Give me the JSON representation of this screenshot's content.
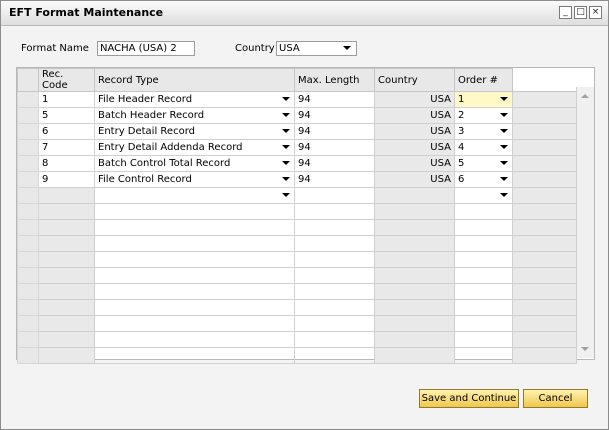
{
  "window": {
    "title": "EFT Format Maintenance"
  },
  "form": {
    "format_name_label": "Format Name",
    "format_name_value": "NACHA (USA) 2",
    "country_label": "Country",
    "country_value": "USA"
  },
  "grid": {
    "columns": [
      "Rec. Code",
      "Record Type",
      "Max. Length",
      "Country",
      "Order #"
    ],
    "rows": [
      {
        "code": "1",
        "type": "File Header Record",
        "length": "94",
        "country": "USA",
        "order": "1"
      },
      {
        "code": "5",
        "type": "Batch Header Record",
        "length": "94",
        "country": "USA",
        "order": "2"
      },
      {
        "code": "6",
        "type": "Entry Detail Record",
        "length": "94",
        "country": "USA",
        "order": "3"
      },
      {
        "code": "7",
        "type": "Entry Detail Addenda Record",
        "length": "94",
        "country": "USA",
        "order": "4"
      },
      {
        "code": "8",
        "type": "Batch Control Total Record",
        "length": "94",
        "country": "USA",
        "order": "5"
      },
      {
        "code": "9",
        "type": "File Control Record",
        "length": "94",
        "country": "USA",
        "order": "6"
      }
    ]
  },
  "buttons": {
    "save_continue": "Save and Continue",
    "cancel": "Cancel"
  },
  "colors": {
    "selected_cell": "#fff8c7",
    "button_face": "#f0c74c"
  }
}
